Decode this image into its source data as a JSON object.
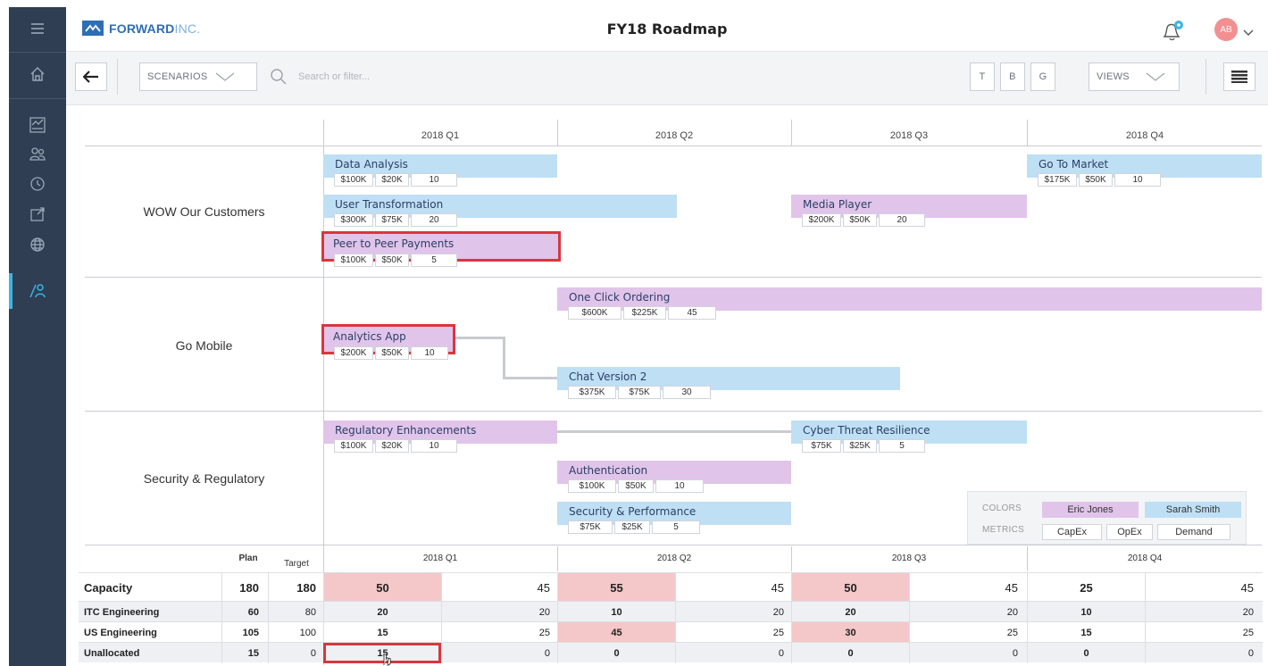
{
  "app": {
    "brand_primary": "FORWARD",
    "brand_secondary": "INC.",
    "title": "FY18 Roadmap",
    "avatar_initials": "AB",
    "accent": "#2f6eb3"
  },
  "sidebar": {
    "items": [
      {
        "icon": "menu-icon"
      },
      {
        "icon": "home-icon"
      },
      {
        "icon": "dashboard-icon"
      },
      {
        "icon": "people-icon"
      },
      {
        "icon": "clock-icon"
      },
      {
        "icon": "inbox-icon"
      },
      {
        "icon": "globe-icon"
      },
      {
        "icon": "roadmap-icon",
        "active": true
      }
    ]
  },
  "toolbar": {
    "scenarios_label": "SCENARIOS",
    "search_placeholder": "Search or filter...",
    "t_label": "T",
    "b_label": "B",
    "g_label": "G",
    "views_label": "VIEWS"
  },
  "quarters": [
    "2018 Q1",
    "2018 Q2",
    "2018 Q3",
    "2018 Q4"
  ],
  "themes": [
    "WOW Our Customers",
    "Go Mobile",
    "Security & Regulatory"
  ],
  "initiatives": [
    {
      "name": "Data Analysis",
      "capex": "$100K",
      "opex": "$20K",
      "demand": "10",
      "color": "blue"
    },
    {
      "name": "User Transformation",
      "capex": "$300K",
      "opex": "$75K",
      "demand": "20",
      "color": "blue"
    },
    {
      "name": "Peer to Peer Payments",
      "capex": "$100K",
      "opex": "$50K",
      "demand": "5",
      "color": "purple",
      "selected": true
    },
    {
      "name": "Media Player",
      "capex": "$200K",
      "opex": "$50K",
      "demand": "20",
      "color": "purple"
    },
    {
      "name": "Go To Market",
      "capex": "$175K",
      "opex": "$50K",
      "demand": "10",
      "color": "blue"
    },
    {
      "name": "One Click Ordering",
      "capex": "$600K",
      "opex": "$225K",
      "demand": "45",
      "color": "purple"
    },
    {
      "name": "Analytics App",
      "capex": "$200K",
      "opex": "$50K",
      "demand": "10",
      "color": "purple",
      "selected": true
    },
    {
      "name": "Chat Version 2",
      "capex": "$375K",
      "opex": "$75K",
      "demand": "30",
      "color": "blue"
    },
    {
      "name": "Regulatory Enhancements",
      "capex": "$100K",
      "opex": "$20K",
      "demand": "10",
      "color": "purple"
    },
    {
      "name": "Cyber Threat Resilience",
      "capex": "$75K",
      "opex": "$25K",
      "demand": "5",
      "color": "blue"
    },
    {
      "name": "Authentication",
      "capex": "$100K",
      "opex": "$50K",
      "demand": "10",
      "color": "purple"
    },
    {
      "name": "Security & Performance",
      "capex": "$75K",
      "opex": "$25K",
      "demand": "5",
      "color": "blue"
    }
  ],
  "legend": {
    "colors_label": "COLORS",
    "metrics_label": "METRICS",
    "color_items": [
      {
        "label": "Eric Jones",
        "color": "#e1c4ea"
      },
      {
        "label": "Sarah Smith",
        "color": "#bfdff5"
      }
    ],
    "metric_items": [
      "CapEx",
      "OpEx",
      "Demand"
    ]
  },
  "capacity": {
    "plan_label": "Plan",
    "target_label": "Target",
    "rows": [
      {
        "name": "Capacity",
        "plan": "180",
        "target": "180",
        "q": [
          [
            "50",
            "45"
          ],
          [
            "55",
            "45"
          ],
          [
            "50",
            "45"
          ],
          [
            "25",
            "45"
          ]
        ],
        "red": [
          true,
          true,
          true,
          false
        ]
      },
      {
        "name": "ITC Engineering",
        "plan": "60",
        "target": "80",
        "q": [
          [
            "20",
            "20"
          ],
          [
            "10",
            "20"
          ],
          [
            "20",
            "20"
          ],
          [
            "10",
            "20"
          ]
        ],
        "red": [
          false,
          false,
          false,
          false
        ]
      },
      {
        "name": "US Engineering",
        "plan": "105",
        "target": "100",
        "q": [
          [
            "15",
            "25"
          ],
          [
            "45",
            "25"
          ],
          [
            "30",
            "25"
          ],
          [
            "15",
            "25"
          ]
        ],
        "red": [
          false,
          true,
          true,
          false
        ]
      },
      {
        "name": "Unallocated",
        "plan": "15",
        "target": "0",
        "q": [
          [
            "15",
            "0"
          ],
          [
            "0",
            "0"
          ],
          [
            "0",
            "0"
          ],
          [
            "0",
            "0"
          ]
        ],
        "red": [
          false,
          false,
          false,
          false
        ]
      }
    ]
  }
}
